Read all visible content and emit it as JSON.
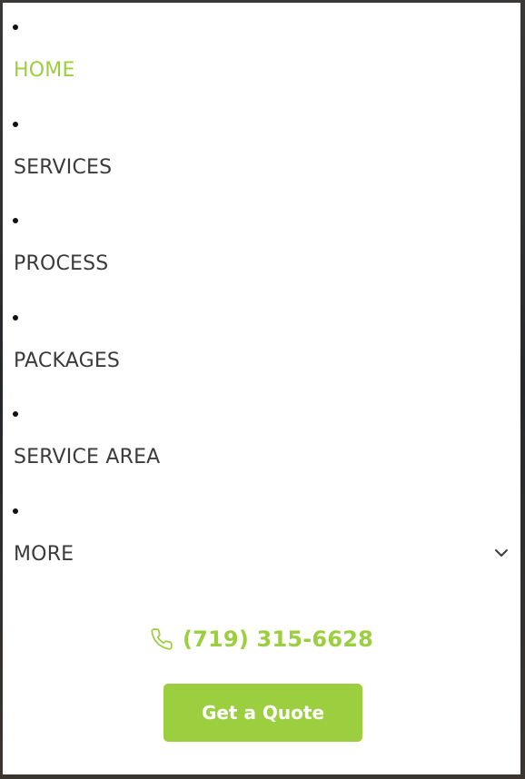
{
  "colors": {
    "accent": "#9ccf3f",
    "text": "#3b3b3b",
    "panel_bg": "#ffffff"
  },
  "nav": {
    "items": [
      {
        "label": "HOME",
        "active": true
      },
      {
        "label": "SERVICES",
        "active": false
      },
      {
        "label": "PROCESS",
        "active": false
      },
      {
        "label": "PACKAGES",
        "active": false
      },
      {
        "label": "SERVICE AREA",
        "active": false
      },
      {
        "label": "MORE",
        "active": false,
        "has_dropdown": true
      }
    ]
  },
  "contact": {
    "phone": "(719) 315-6628",
    "phone_icon": "phone-icon"
  },
  "cta": {
    "label": "Get a Quote"
  }
}
